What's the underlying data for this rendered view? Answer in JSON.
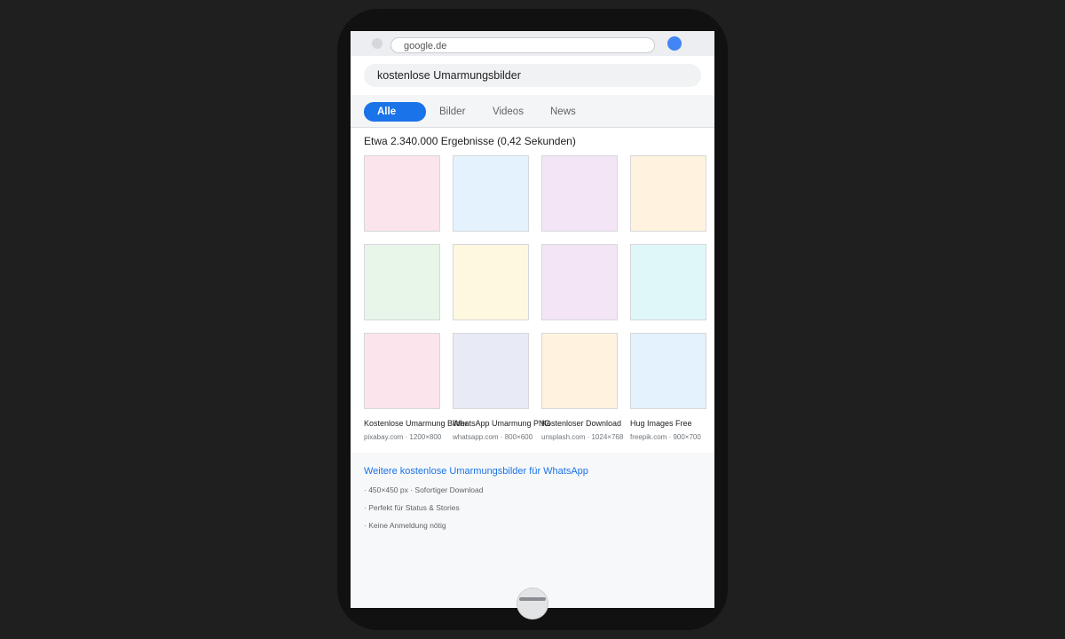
{
  "browser": {
    "url": "google.de",
    "avatar_color": "#4285f4"
  },
  "search": {
    "query": "kostenlose Umarmungsbilder"
  },
  "tabs": [
    {
      "label": "Alle",
      "active": true
    },
    {
      "label": "Bilder",
      "active": false
    },
    {
      "label": "Videos",
      "active": false
    },
    {
      "label": "News",
      "active": false
    }
  ],
  "results": {
    "stats": "Etwa 2.340.000 Ergebnisse (0,42 Sekunden)",
    "thumbnail_colors": [
      "#fce4ec",
      "#e3f2fd",
      "#f3e5f5",
      "#fff3e0",
      "#e8f5e9",
      "#fff8e1",
      "#f3e5f5",
      "#e0f7fa",
      "#fce4ec",
      "#e8eaf6",
      "#fff3e0",
      "#e3f2fd"
    ],
    "captions": [
      {
        "title": "Kostenlose Umarmung Bilder",
        "meta": "pixabay.com · 1200×800"
      },
      {
        "title": "WhatsApp Umarmung PNG",
        "meta": "whatsapp.com · 800×600"
      },
      {
        "title": "Kostenloser Download",
        "meta": "unsplash.com · 1024×768"
      },
      {
        "title": "Hug Images Free",
        "meta": "freepik.com · 900×700"
      }
    ]
  },
  "more": {
    "link": "Weitere kostenlose Umarmungsbilder für WhatsApp",
    "bullets": [
      "· 450×450 px · Sofortiger Download",
      "· Perfekt für Status & Stories",
      "· Keine Anmeldung nötig"
    ]
  },
  "accent_color": "#1a73e8"
}
